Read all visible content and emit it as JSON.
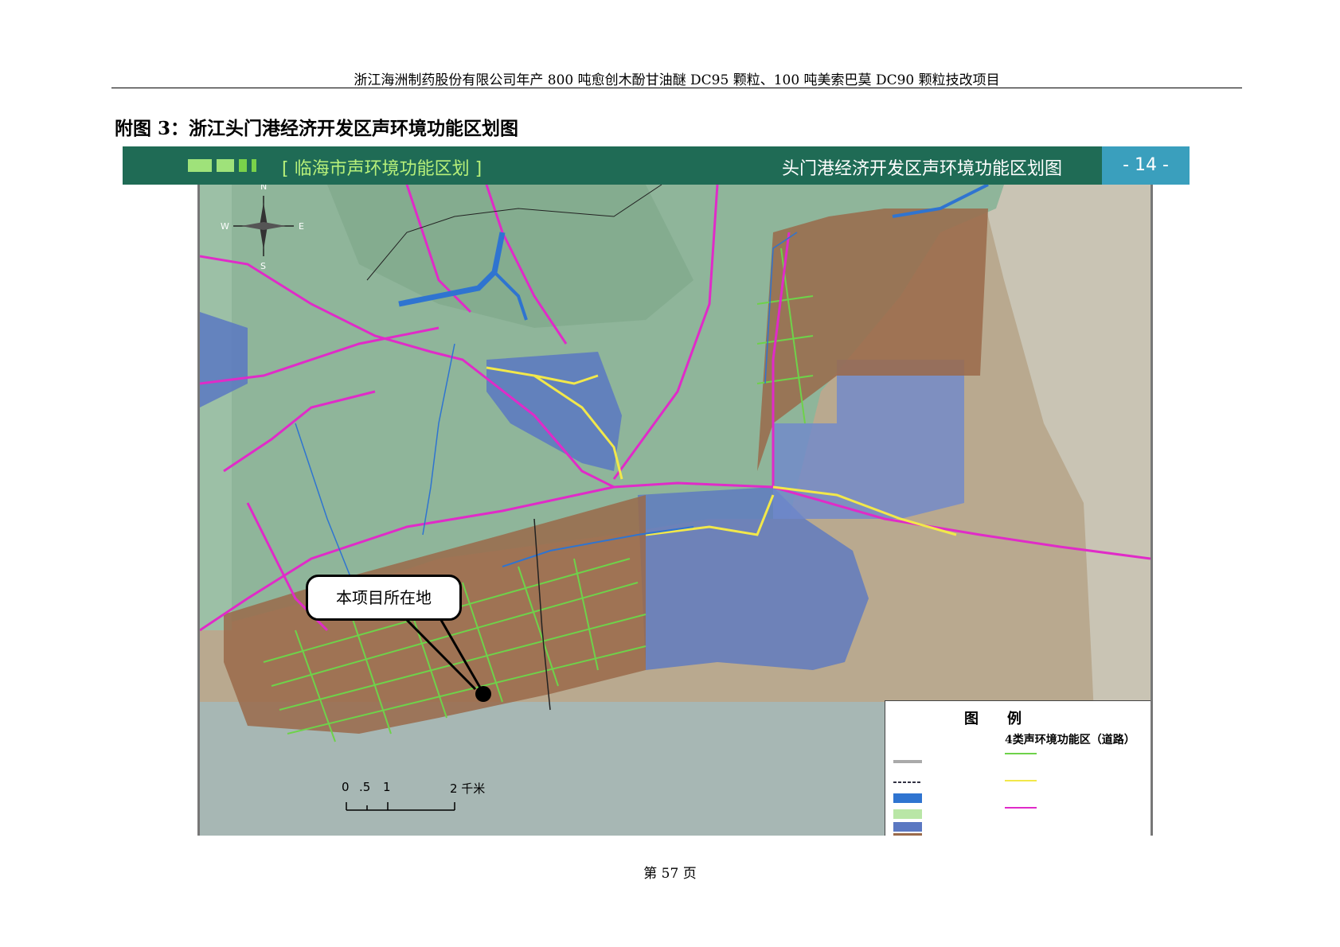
{
  "header": {
    "text": "浙江海洲制药股份有限公司年产 800 吨愈创木酚甘油醚 DC95 颗粒、100 吨美索巴莫 DC90 颗粒技改项目"
  },
  "figure": {
    "title": "附图 3：浙江头门港经济开发区声环境功能区划图"
  },
  "banner": {
    "subtitle": "[ 临海市声环境功能区划 ]",
    "title": "头门港经济开发区声环境功能区划图",
    "map_number": "- 14 -"
  },
  "compass": {
    "n": "N",
    "s": "S",
    "e": "E",
    "w": "W"
  },
  "map": {
    "colors": {
      "land": "#8fb59a",
      "water": "#b7a58e",
      "zone2": "#5b78c2",
      "zone3": "#9a6a4a",
      "road_magenta": "#e02bc8",
      "road_yellow": "#f2e84a",
      "river": "#2f74d0",
      "road_green": "#6ed24a"
    },
    "callout": "本项目所在地",
    "scale": {
      "labels": [
        "0",
        ".5",
        "1",
        "2 千米"
      ]
    }
  },
  "legend": {
    "title": "图　　例",
    "road_heading": "4类声环境功能区（道路）"
  },
  "footer": {
    "page": "第 57 页"
  }
}
